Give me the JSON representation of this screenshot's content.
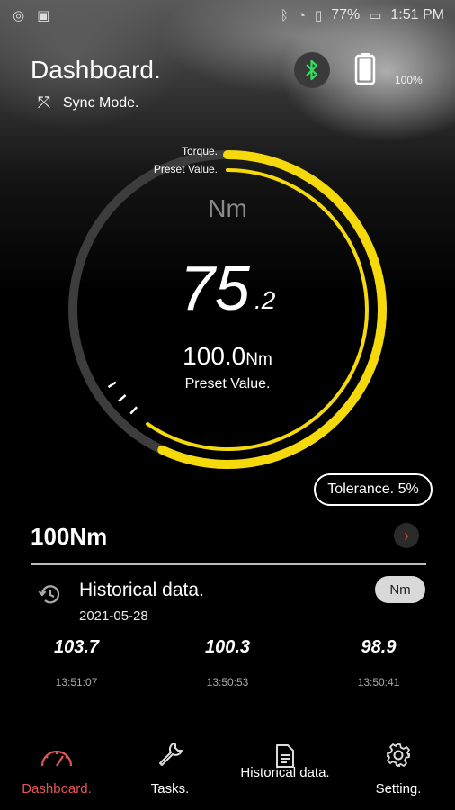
{
  "status_bar": {
    "battery_percent": "77%",
    "time": "1:51 PM"
  },
  "header": {
    "title": "Dashboard.",
    "sync_label": "Sync Mode.",
    "battery_level": "100%"
  },
  "gauge": {
    "torque_label": "Torque.",
    "preset_label_top": "Preset Value.",
    "unit": "Nm",
    "current_int": "75",
    "current_dec": ".2",
    "preset_number": "100.0",
    "preset_unit": "Nm",
    "preset_caption": "Preset Value.",
    "torque_fraction": 0.752,
    "colors": {
      "accent": "#f5d90a",
      "track": "#3d3d3d"
    }
  },
  "tolerance": {
    "label": "Tolerance. 5%"
  },
  "task": {
    "name": "100Nm"
  },
  "history": {
    "title": "Historical data.",
    "date": "2021-05-28",
    "unit_chip": "Nm",
    "records": [
      {
        "value": "103.7",
        "time": "13:51:07"
      },
      {
        "value": "100.3",
        "time": "13:50:53"
      },
      {
        "value": "98.9",
        "time": "13:50:41"
      }
    ]
  },
  "nav": {
    "items": [
      {
        "label": "Dashboard.",
        "icon": "gauge-icon",
        "active": true
      },
      {
        "label": "Tasks.",
        "icon": "wrench-icon",
        "active": false
      },
      {
        "label": "Historical data.",
        "icon": "document-icon",
        "active": false
      },
      {
        "label": "Setting.",
        "icon": "gear-icon",
        "active": false
      }
    ],
    "active_color": "#e35555"
  }
}
